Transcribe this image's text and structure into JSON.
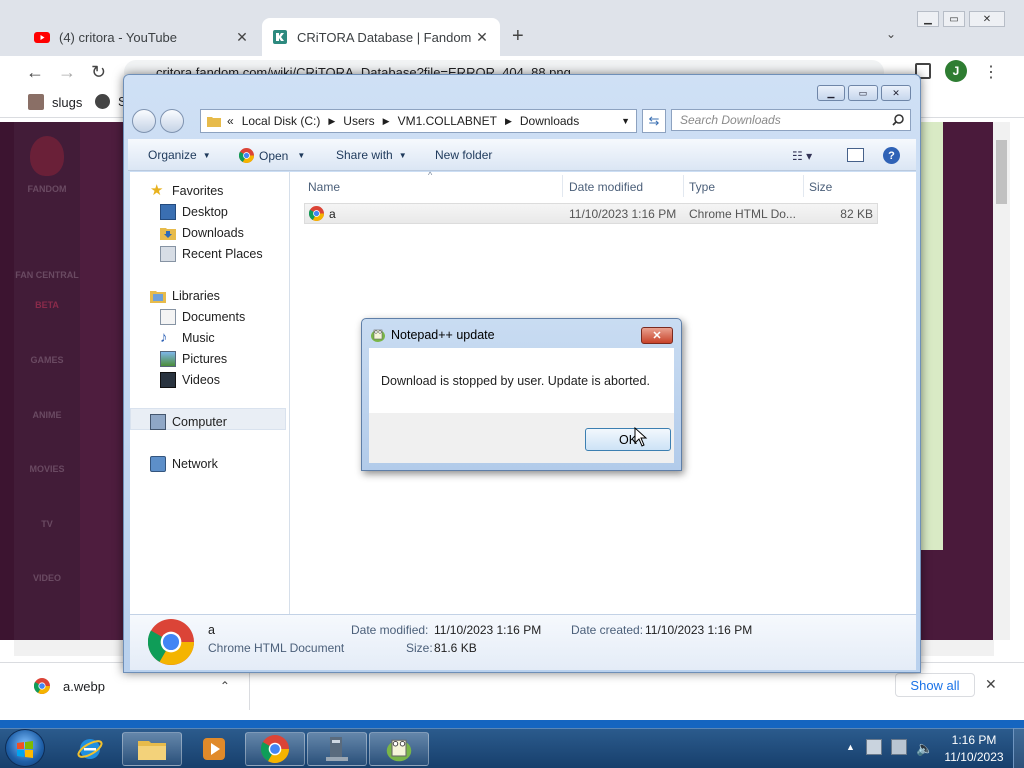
{
  "chrome": {
    "tabs": [
      {
        "title": "(4) critora - YouTube"
      },
      {
        "title": "CRiTORA Database | Fandom"
      }
    ],
    "url": "critora.fandom.com/wiki/CRiTORA_Database?file=ERROR_404_88.png",
    "profile_initial": "J",
    "bookmarks": [
      {
        "label": "slugs"
      },
      {
        "label": "S"
      }
    ],
    "fandom_rail": [
      "FANDOM",
      "FAN CENTRAL",
      "BETA",
      "GAMES",
      "ANIME",
      "MOVIES",
      "TV",
      "VIDEO"
    ],
    "download": {
      "filename": "a.webp",
      "show_all": "Show all"
    }
  },
  "explorer": {
    "breadcrumb": [
      "Local Disk (C:)",
      "Users",
      "VM1.COLLABNET",
      "Downloads"
    ],
    "breadcrumb_prefix": "«",
    "search_placeholder": "Search Downloads",
    "commands": {
      "organize": "Organize",
      "open": "Open",
      "share_with": "Share with",
      "new_folder": "New folder"
    },
    "nav": {
      "favorites": "Favorites",
      "desktop": "Desktop",
      "downloads": "Downloads",
      "recent_places": "Recent Places",
      "libraries": "Libraries",
      "documents": "Documents",
      "music": "Music",
      "pictures": "Pictures",
      "videos": "Videos",
      "computer": "Computer",
      "network": "Network"
    },
    "columns": {
      "name": "Name",
      "date_modified": "Date modified",
      "type": "Type",
      "size": "Size"
    },
    "files": [
      {
        "name": "a",
        "date_modified": "11/10/2023 1:16 PM",
        "type": "Chrome HTML Do...",
        "size": "82 KB"
      }
    ],
    "details": {
      "name": "a",
      "type": "Chrome HTML Document",
      "date_modified_label": "Date modified:",
      "date_modified": "11/10/2023 1:16 PM",
      "date_created_label": "Date created:",
      "date_created": "11/10/2023 1:16 PM",
      "size_label": "Size:",
      "size": "81.6 KB"
    }
  },
  "dialog": {
    "title": "Notepad++ update",
    "message": "Download is stopped by user. Update is aborted.",
    "ok": "OK"
  },
  "taskbar": {
    "time": "1:16 PM",
    "date": "11/10/2023"
  },
  "colors": {
    "chrome_tabstrip": "#dfe3ea",
    "taskbar": "#1f4a7a",
    "dialog_frame": "#c9dcf2",
    "page_bg": "#3c1430"
  }
}
